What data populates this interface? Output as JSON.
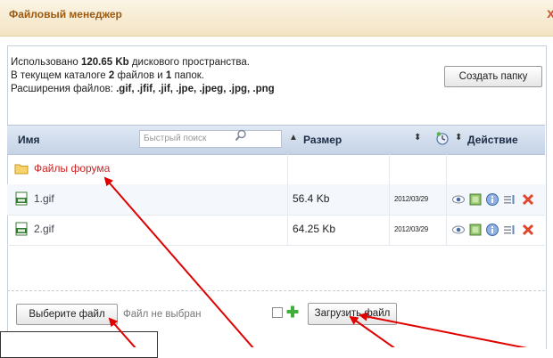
{
  "dialog": {
    "title": "Файловый менеджер",
    "close_glyph": "x"
  },
  "info": {
    "line1_prefix": "Использовано ",
    "line1_value": "120.65 Kb",
    "line1_suffix": " дискового пространства.",
    "line2_prefix": "В текущем каталоге ",
    "line2_files": "2",
    "line2_mid": " файлов и ",
    "line2_folders": "1",
    "line2_suffix": " папок.",
    "line3_prefix": "Расширения файлов: ",
    "line3_value": ".gif, .jfif, .jif, .jpe, .jpeg, .jpg, .png"
  },
  "toolbar": {
    "create_folder_label": "Создать папку"
  },
  "table": {
    "headers": {
      "name": "Имя",
      "size": "Размер",
      "action": "Действие"
    },
    "search_placeholder": "Быстрый поиск",
    "sort_up_glyph": "▲",
    "sort_both_glyph": "⬍",
    "rows": [
      {
        "type": "folder",
        "name": "Файлы форума",
        "size": "",
        "date": ""
      },
      {
        "type": "file",
        "name": "1.gif",
        "size": "56.4 Kb",
        "date": "2012/03/29"
      },
      {
        "type": "file",
        "name": "2.gif",
        "size": "64.25 Kb",
        "date": "2012/03/29"
      }
    ]
  },
  "upload": {
    "choose_file_label": "Выберите файл",
    "no_file_text": "Файл не выбран",
    "upload_label": "Загрузить файл"
  },
  "colors": {
    "title": "#9a5a12",
    "folder_link": "#cc2222",
    "arrow": "#e00000",
    "header_bg": "#c5d3e6"
  }
}
